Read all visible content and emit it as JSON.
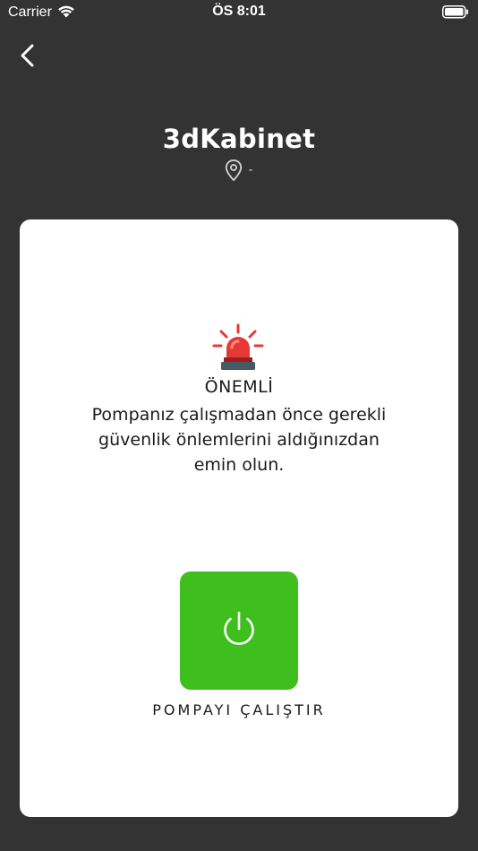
{
  "status_bar": {
    "carrier": "Carrier",
    "time": "ÖS 8:01"
  },
  "header": {
    "title": "3dKabinet",
    "location": "-"
  },
  "card": {
    "warning_title": "ÖNEMLİ",
    "warning_text": "Pompanız çalışmadan önce gerekli güvenlik önlemlerini aldığınızdan emin olun.",
    "start_label": "POMPAYI ÇALIŞTIR"
  },
  "icons": {
    "back": "chevron-left-icon",
    "location": "location-pin-icon",
    "alarm": "siren-icon",
    "power": "power-icon",
    "wifi": "wifi-icon",
    "battery": "battery-icon"
  },
  "colors": {
    "background": "#333333",
    "card": "#ffffff",
    "start_button": "#3fbf1d",
    "siren": "#e53935"
  }
}
